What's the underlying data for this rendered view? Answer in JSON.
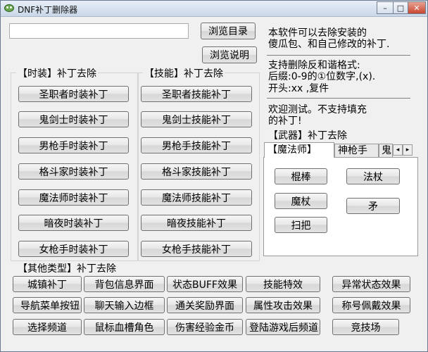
{
  "window": {
    "title": "DNF补丁删除器",
    "controls": {
      "minimize": "–",
      "maximize": "□",
      "close": "✕"
    }
  },
  "toolbar": {
    "browse_dir": "浏览目录",
    "browse_help": "浏览说明"
  },
  "search": {
    "value": ""
  },
  "info": {
    "line1": "本软件可以去除安装的",
    "line2": "傻瓜包、和自己修改的补丁.",
    "line3": "支持删除反和谐格式:",
    "line4": "后缀:0-9的①位数字,(x).",
    "line5": "开头:xx ,复件",
    "line6": "欢迎测试。不支持填充",
    "line7": "的补丁!"
  },
  "fashion_group": {
    "title": "【时装】补丁去除",
    "buttons": [
      "圣职者时装补丁",
      "鬼剑士时装补丁",
      "男枪手时装补丁",
      "格斗家时装补丁",
      "魔法师时装补丁",
      "暗夜时装补丁",
      "女枪手时装补丁"
    ]
  },
  "skill_group": {
    "title": "【技能】补丁去除",
    "buttons": [
      "圣职者技能补丁",
      "鬼剑士技能补丁",
      "男枪手技能补丁",
      "格斗家技能补丁",
      "魔法师技能补丁",
      "暗夜技能补丁",
      "女枪手技能补丁"
    ]
  },
  "weapon_group": {
    "title": "【武器】补丁去除",
    "tabs": [
      "【魔法师】",
      "神枪手",
      "鬼"
    ],
    "buttons": [
      "棍棒",
      "法杖",
      "魔杖",
      "矛",
      "扫把"
    ]
  },
  "other_group": {
    "title": "【其他类型】补丁去除",
    "buttons": [
      "城镇补丁",
      "背包信息界面",
      "状态BUFF效果",
      "技能特效",
      "异常状态效果",
      "导航菜单按钮",
      "聊天输入边框",
      "通关奖励界面",
      "属性攻击效果",
      "称号佩戴效果",
      "选择频道",
      "鼠标血槽角色",
      "伤害经验金币",
      "登陆游戏后频道",
      "竞技场"
    ]
  }
}
